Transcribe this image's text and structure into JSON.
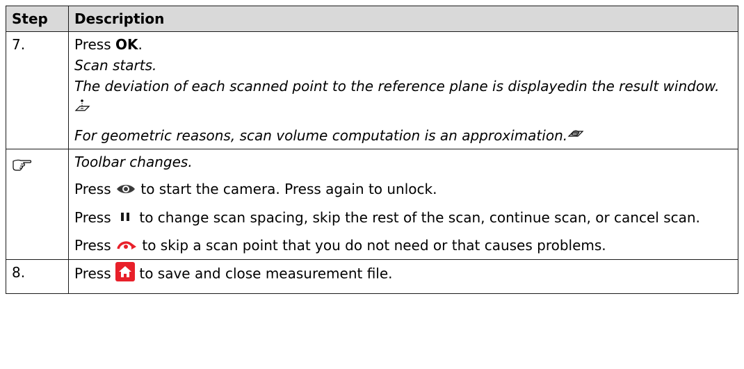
{
  "table": {
    "headers": {
      "step": "Step",
      "description": "Description"
    },
    "row7": {
      "step": "7.",
      "press_prefix": "Press ",
      "press_key": "OK",
      "press_suffix": ".",
      "scan_starts": "Scan starts.",
      "deviation_text": "The deviation of each scanned point to the reference plane is displayedin the result window.",
      "geometric_text": "For geometric reasons, scan volume computation is an approximation.",
      "deviation_icon": "reference-plane-icon",
      "volume_icon": "volume-icon"
    },
    "tip": {
      "icon": "pointing-hand-icon",
      "toolbar_changes": "Toolbar changes.",
      "camera": {
        "prefix": "Press",
        "icon": "eye-icon",
        "suffix": "to start the camera. Press again to unlock."
      },
      "pause": {
        "prefix": "Press",
        "icon": "pause-icon",
        "suffix": "to change scan spacing, skip the rest of the scan, continue scan, or cancel scan."
      },
      "skip": {
        "prefix": "Press",
        "icon": "skip-point-icon",
        "suffix": "to skip a scan point that you do not need or that causes problems."
      }
    },
    "row8": {
      "step": "8.",
      "prefix": "Press",
      "icon": "home-icon",
      "suffix": "to save and close measurement file."
    }
  },
  "colors": {
    "header_bg": "#d9d9d9",
    "icon_red": "#e8202a",
    "icon_dark": "#3a3a3a"
  }
}
